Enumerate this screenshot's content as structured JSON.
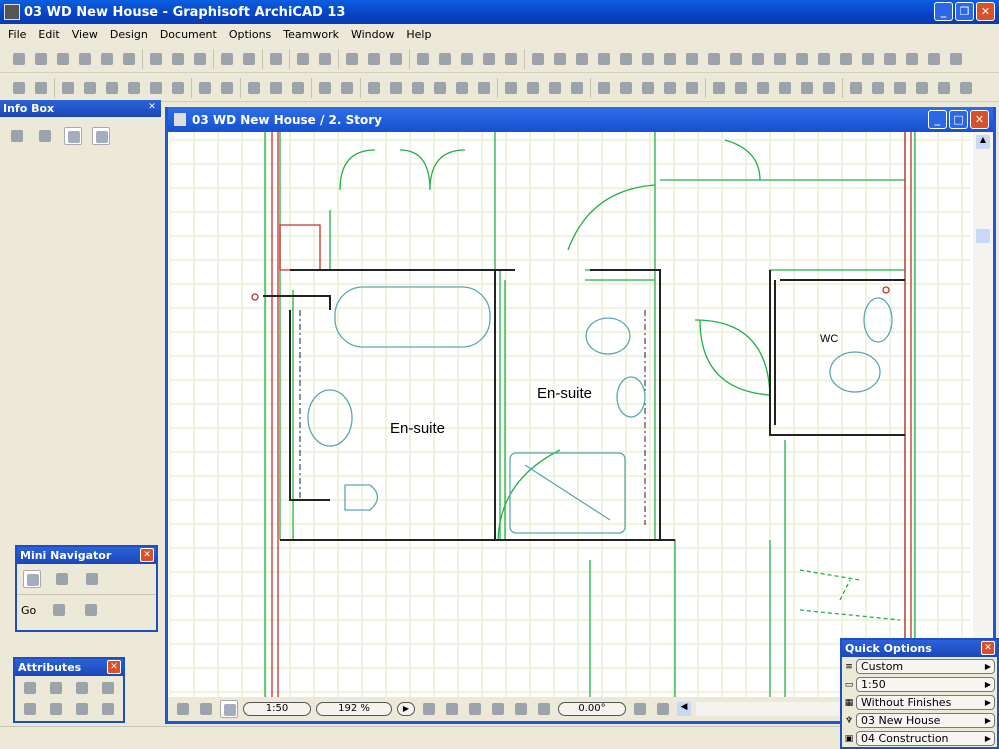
{
  "app": {
    "title": "03 WD New House - Graphisoft ArchiCAD 13"
  },
  "menu": [
    "File",
    "Edit",
    "View",
    "Design",
    "Document",
    "Options",
    "Teamwork",
    "Window",
    "Help"
  ],
  "info_box": {
    "title": "Info Box"
  },
  "document": {
    "title": "03 WD New House / 2. Story",
    "rooms": [
      {
        "label": "En-suite"
      },
      {
        "label": "En-suite"
      },
      {
        "label": "WC"
      }
    ],
    "scale": "1:50",
    "zoom": "192 %",
    "angle": "0.00°"
  },
  "mini_navigator": {
    "title": "Mini Navigator",
    "go_label": "Go"
  },
  "attributes": {
    "title": "Attributes"
  },
  "quick_options": {
    "title": "Quick Options",
    "items": [
      {
        "icon": "layers-icon",
        "label": "Custom"
      },
      {
        "icon": "scale-icon",
        "label": "1:50"
      },
      {
        "icon": "model-view-icon",
        "label": "Without Finishes"
      },
      {
        "icon": "pen-set-icon",
        "label": "03 New House"
      },
      {
        "icon": "dimension-icon",
        "label": "04 Construction"
      }
    ]
  },
  "colors": {
    "titlebar": "#0842c4",
    "wall_green": "#22b04a",
    "wall_red": "#c83030",
    "fixture": "#5aa8b0",
    "grid": "#dfe8b8"
  }
}
